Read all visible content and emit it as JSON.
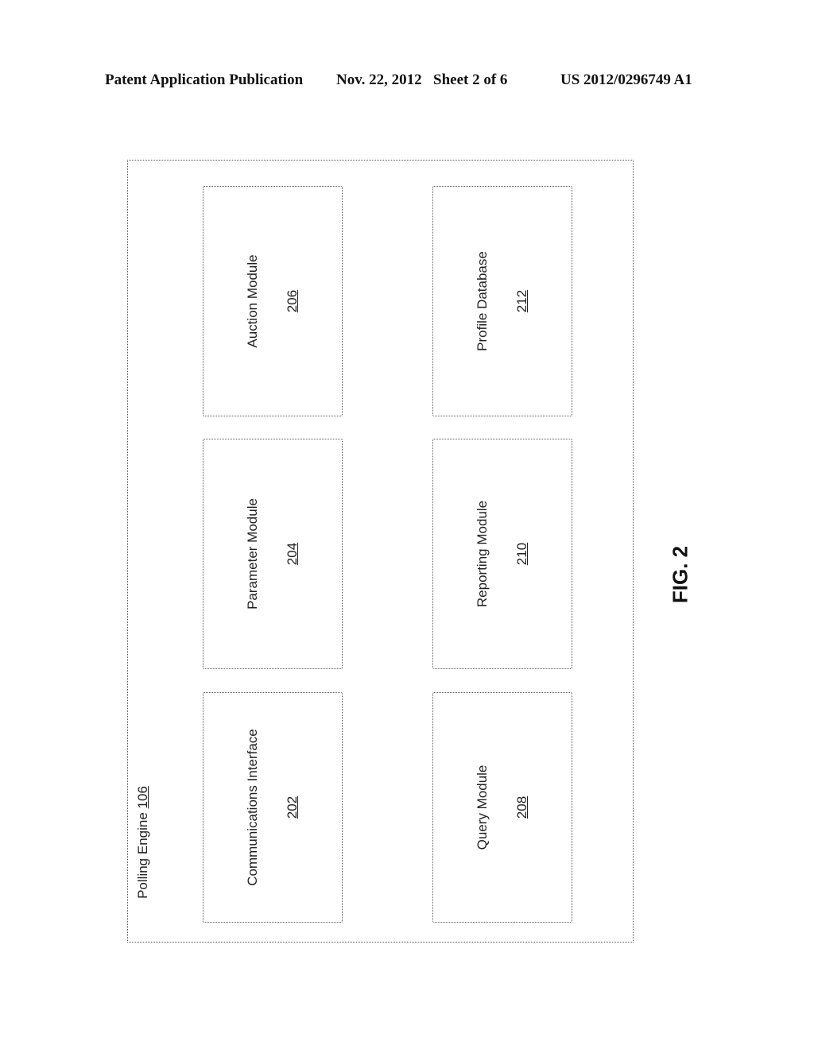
{
  "header": {
    "publication": "Patent Application Publication",
    "date": "Nov. 22, 2012",
    "sheet": "Sheet 2 of 6",
    "number": "US 2012/0296749 A1"
  },
  "diagram": {
    "container": {
      "label": "Polling Engine",
      "ref": "106"
    },
    "modules": [
      {
        "name": "Communications Interface",
        "ref": "202"
      },
      {
        "name": "Parameter Module",
        "ref": "204"
      },
      {
        "name": "Auction Module",
        "ref": "206"
      },
      {
        "name": "Query Module",
        "ref": "208"
      },
      {
        "name": "Reporting Module",
        "ref": "210"
      },
      {
        "name": "Profile Database",
        "ref": "212"
      }
    ]
  },
  "figure_label": "FIG. 2"
}
